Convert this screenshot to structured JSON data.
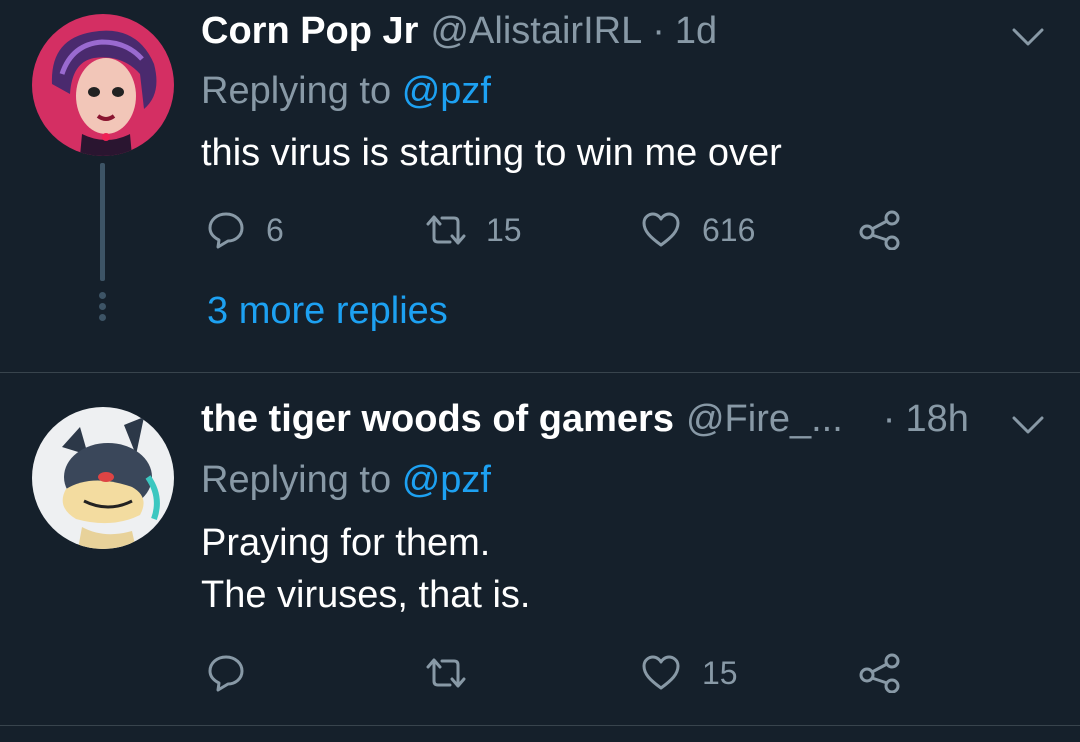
{
  "tweets": [
    {
      "name": "Corn Pop Jr",
      "handle": "@AlistairIRL",
      "separator": "·",
      "time": "1d",
      "replying_prefix": "Replying to",
      "replying_to": "@pzf",
      "text_lines": [
        "this virus is starting to win me over"
      ],
      "actions": {
        "replies": "6",
        "retweets": "15",
        "likes": "616"
      },
      "more_replies": "3 more replies"
    },
    {
      "name": "the tiger woods of gamers",
      "handle": "@Fire_...",
      "separator": "·",
      "time": "18h",
      "replying_prefix": "Replying to",
      "replying_to": "@pzf",
      "text_lines": [
        "Praying for them.",
        "The viruses, that is."
      ],
      "actions": {
        "replies": "",
        "retweets": "",
        "likes": "15"
      }
    }
  ],
  "colors": {
    "background": "#15202b",
    "primary_text": "#ffffff",
    "secondary_text": "#8899a6",
    "accent": "#1da1f2",
    "divider": "#38444d"
  },
  "icons": [
    "avatar-image",
    "chevron-down-icon",
    "reply-icon",
    "retweet-icon",
    "like-icon",
    "share-icon"
  ]
}
